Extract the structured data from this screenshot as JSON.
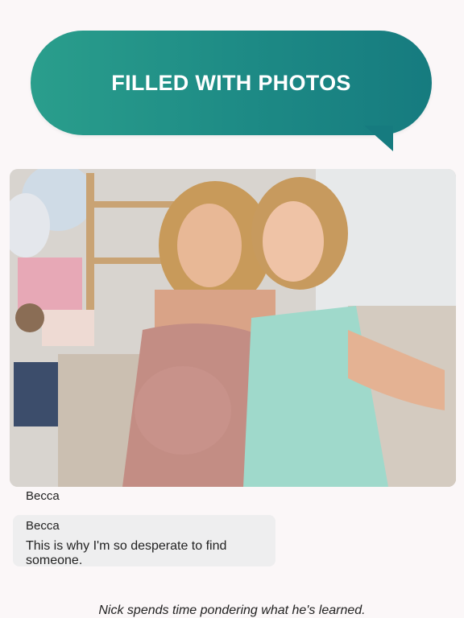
{
  "banner": {
    "title": "FILLED WITH PHOTOS"
  },
  "photo": {
    "description_icon": "photo-image"
  },
  "chat": {
    "sender_label": "Becca",
    "message": {
      "name": "Becca",
      "text": "This is why I'm so desperate to find someone."
    }
  },
  "narration": "Nick spends time pondering what he's learned.",
  "colors": {
    "banner": "#1d8a85",
    "background": "#fbf7f8",
    "bubble": "#eeeeef"
  }
}
